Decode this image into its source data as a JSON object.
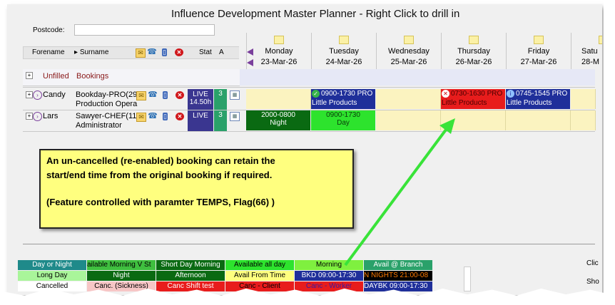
{
  "window": {
    "title": "Influence Development Master Planner  -  Right Click to drill in"
  },
  "filter": {
    "postcode_label": "Postcode:",
    "postcode_value": ""
  },
  "columns": {
    "forename": "Forename",
    "surname": "Surname",
    "stat": "Stat",
    "a": "A"
  },
  "days": [
    {
      "name": "Monday",
      "date": "23-Mar-26"
    },
    {
      "name": "Tuesday",
      "date": "24-Mar-26"
    },
    {
      "name": "Wednesday",
      "date": "25-Mar-26"
    },
    {
      "name": "Thursday",
      "date": "26-Mar-26"
    },
    {
      "name": "Friday",
      "date": "27-Mar-26"
    },
    {
      "name": "Satu",
      "date": "28-M"
    }
  ],
  "unfilled": {
    "label1": "Unfilled",
    "label2": "Bookings"
  },
  "people": [
    {
      "forename": "Candy",
      "surname_line1": "Bookday-PRO(29",
      "surname_line2": "Production Opera",
      "status": "LIVE",
      "hours": "14.50h",
      "count": "3"
    },
    {
      "forename": "Lars",
      "surname_line1": "Sawyer-CHEF(11",
      "surname_line2": "Administrator",
      "status": "LIVE",
      "hours": "",
      "count": "3"
    }
  ],
  "bookings": {
    "candy_tue_time": "0900-1730 PRO",
    "candy_tue_client": "Little Products",
    "candy_thu_time": "0730-1630 PRO",
    "candy_thu_client": "Little Products",
    "candy_fri_time": "0745-1545 PRO",
    "candy_fri_client": "Little Products",
    "lars_mon_time": "2000-0800",
    "lars_mon_label": "Night",
    "lars_tue_time": "0900-1730",
    "lars_tue_label": "Day"
  },
  "callout": {
    "line1": "An un-cancelled (re-enabled) booking can retain the",
    "line2": "start/end time from the original booking if required.",
    "line3": "(Feature controlled with paramter TEMPS, Flag(66) )"
  },
  "legend": {
    "row1": [
      "Day or Night",
      "ailable Morning V St",
      "Short Day Morning",
      "Available all day",
      "Morning",
      "Avail @ Branch"
    ],
    "row2": [
      "Long Day",
      "Night",
      "Afternoon",
      "Avail From Time",
      "BKD 09:00-17:30",
      "N NIGHTS 21:00-08"
    ],
    "row3": [
      "Cancelled",
      "Canc. (Sickness)",
      "Canc Shift test",
      "Canc - Client",
      "Canc - Worker",
      "DAYBK 09:00-17:30"
    ]
  },
  "side_labels": {
    "a": "Clic",
    "b": "Sho"
  },
  "colors": {
    "live": "#3a3690",
    "count": "#2aa16a",
    "blue_booking": "#1f2f9a",
    "red_booking": "#e81c1c",
    "night": "#0a6a12",
    "day": "#2de32d",
    "free": "#fbf3c0",
    "callout": "#ffff7f",
    "arrow": "#39e339"
  },
  "icons": [
    "email-icon",
    "phone-icon",
    "mobile-icon",
    "cancel-icon",
    "calendar-icon",
    "check-icon",
    "arrow-left-icon"
  ]
}
